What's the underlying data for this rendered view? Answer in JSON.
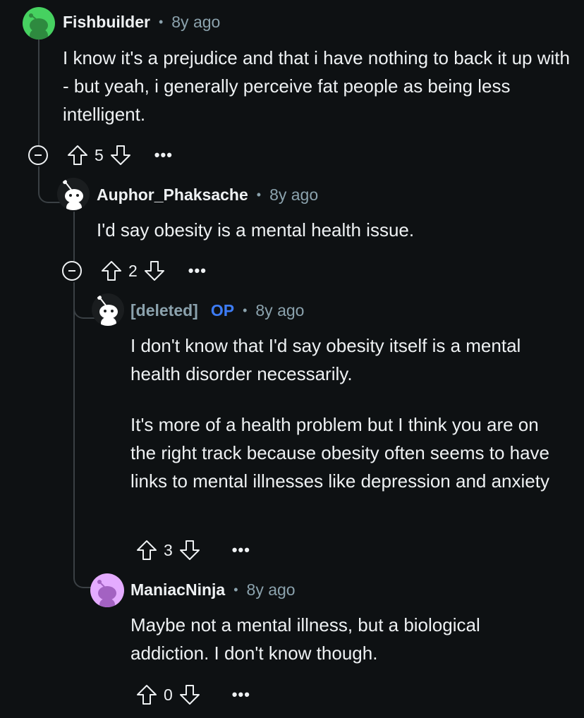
{
  "comments": [
    {
      "author": "Fishbuilder",
      "time": "8y ago",
      "body": [
        "I know it's a prejudice and that i have nothing to back it up with - but yeah, i generally perceive fat people as being less intelligent."
      ],
      "score": "5",
      "avatar_color": "#46d160"
    },
    {
      "author": "Auphor_Phaksache",
      "time": "8y ago",
      "body": [
        "I'd say obesity is a mental health issue."
      ],
      "score": "2",
      "avatar_color": "#ffffff"
    },
    {
      "author": "[deleted]",
      "op_badge": "OP",
      "time": "8y ago",
      "body": [
        "I don't know that I'd say obesity itself is a mental health disorder necessarily.",
        "It's more of a health problem but I think you are on the right track because obesity often seems to have links to mental illnesses like depression and anxiety"
      ],
      "score": "3",
      "avatar_color": "#ffffff"
    },
    {
      "author": "ManiacNinja",
      "time": "8y ago",
      "body": [
        "Maybe not a mental illness, but a biological addiction. I don't know though."
      ],
      "score": "0",
      "avatar_color": "#e4abff"
    }
  ],
  "separator": "•",
  "more_label": "•••",
  "colors": {
    "background": "#0e1113",
    "meta": "#8ba2ad",
    "op": "#3d7cf5",
    "thread": "#3a4044"
  }
}
